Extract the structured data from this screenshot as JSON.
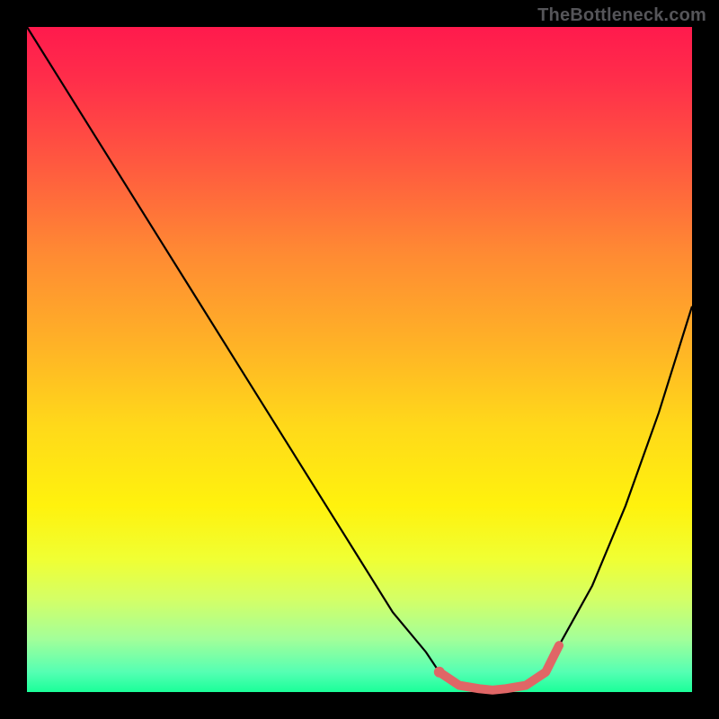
{
  "chart_data": {
    "type": "line",
    "title": "",
    "xlabel": "",
    "ylabel": "",
    "watermark": "TheBottleneck.com",
    "xlim": [
      0,
      100
    ],
    "ylim": [
      0,
      100
    ],
    "grid": false,
    "x": [
      0,
      5,
      10,
      15,
      20,
      25,
      30,
      35,
      40,
      45,
      50,
      55,
      60,
      62,
      65,
      68,
      70,
      72,
      75,
      78,
      80,
      85,
      90,
      95,
      100
    ],
    "values": [
      100,
      92,
      84,
      76,
      68,
      60,
      52,
      44,
      36,
      28,
      20,
      12,
      6,
      3,
      1,
      0.5,
      0.3,
      0.5,
      1,
      3,
      7,
      16,
      28,
      42,
      58
    ],
    "highlight_x": [
      62,
      65,
      68,
      70,
      72,
      75,
      78,
      80
    ],
    "highlight_y": [
      3,
      1,
      0.5,
      0.3,
      0.5,
      1,
      3,
      7
    ],
    "dot": {
      "x": 62,
      "y": 3
    },
    "colors": {
      "gradient_top": "#ff1a4d",
      "gradient_bottom": "#1aff99",
      "curve": "#000000",
      "highlight": "#e06666"
    }
  }
}
